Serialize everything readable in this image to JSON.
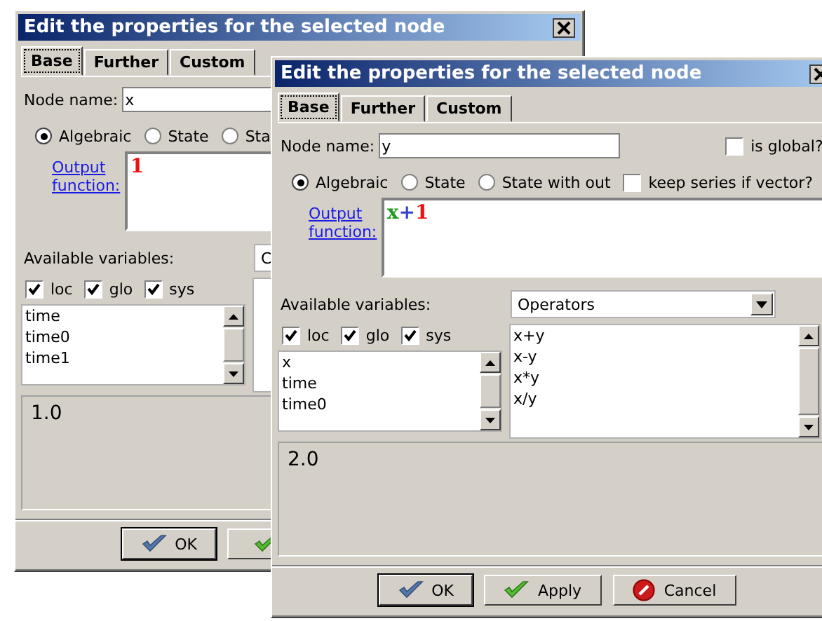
{
  "windows": [
    {
      "title": "Edit the properties for the selected node",
      "tabs": [
        {
          "label": "Base",
          "selected": true
        },
        {
          "label": "Further",
          "selected": false
        },
        {
          "label": "Custom",
          "selected": false
        }
      ],
      "node_name": {
        "label": "Node name:",
        "value": "x"
      },
      "radios": [
        {
          "label": "Algebraic",
          "selected": true
        },
        {
          "label": "State",
          "selected": false
        },
        {
          "label": "Sta",
          "selected": false
        }
      ],
      "output_function": {
        "label": "Output function:",
        "tokens": [
          {
            "text": "1",
            "kind": "number"
          }
        ]
      },
      "variables": {
        "label": "Available variables:",
        "dropdown": "C",
        "filters": [
          {
            "label": "loc",
            "checked": true
          },
          {
            "label": "glo",
            "checked": true
          },
          {
            "label": "sys",
            "checked": true
          }
        ],
        "list": [
          "time",
          "time0",
          "time1"
        ]
      },
      "result": "1.0",
      "buttons": [
        {
          "label": "OK",
          "kind": "ok"
        },
        {
          "kind": "apply"
        }
      ]
    },
    {
      "title": "Edit the properties for the selected node",
      "tabs": [
        {
          "label": "Base",
          "selected": true
        },
        {
          "label": "Further",
          "selected": false
        },
        {
          "label": "Custom",
          "selected": false
        }
      ],
      "node_name": {
        "label": "Node name:",
        "value": "y"
      },
      "global": {
        "label": "is global?",
        "checked": false
      },
      "radios": [
        {
          "label": "Algebraic",
          "selected": true
        },
        {
          "label": "State",
          "selected": false
        },
        {
          "label": "State with out",
          "selected": false
        }
      ],
      "keep_series": {
        "label": "keep series if vector?",
        "checked": false
      },
      "output_function": {
        "label": "Output function:",
        "tokens": [
          {
            "text": "x",
            "kind": "variable"
          },
          {
            "text": "+",
            "kind": "operator"
          },
          {
            "text": "1",
            "kind": "number"
          }
        ]
      },
      "variables": {
        "label": "Available variables:",
        "dropdown": "Operators",
        "filters": [
          {
            "label": "loc",
            "checked": true
          },
          {
            "label": "glo",
            "checked": true
          },
          {
            "label": "sys",
            "checked": true
          }
        ],
        "list": [
          "x",
          "time",
          "time0"
        ],
        "operators": [
          "x+y",
          "x-y",
          "x*y",
          "x/y"
        ]
      },
      "result": "2.0",
      "buttons": [
        {
          "label": "OK",
          "kind": "ok"
        },
        {
          "label": "Apply",
          "kind": "apply"
        },
        {
          "label": "Cancel",
          "kind": "cancel"
        }
      ]
    }
  ]
}
